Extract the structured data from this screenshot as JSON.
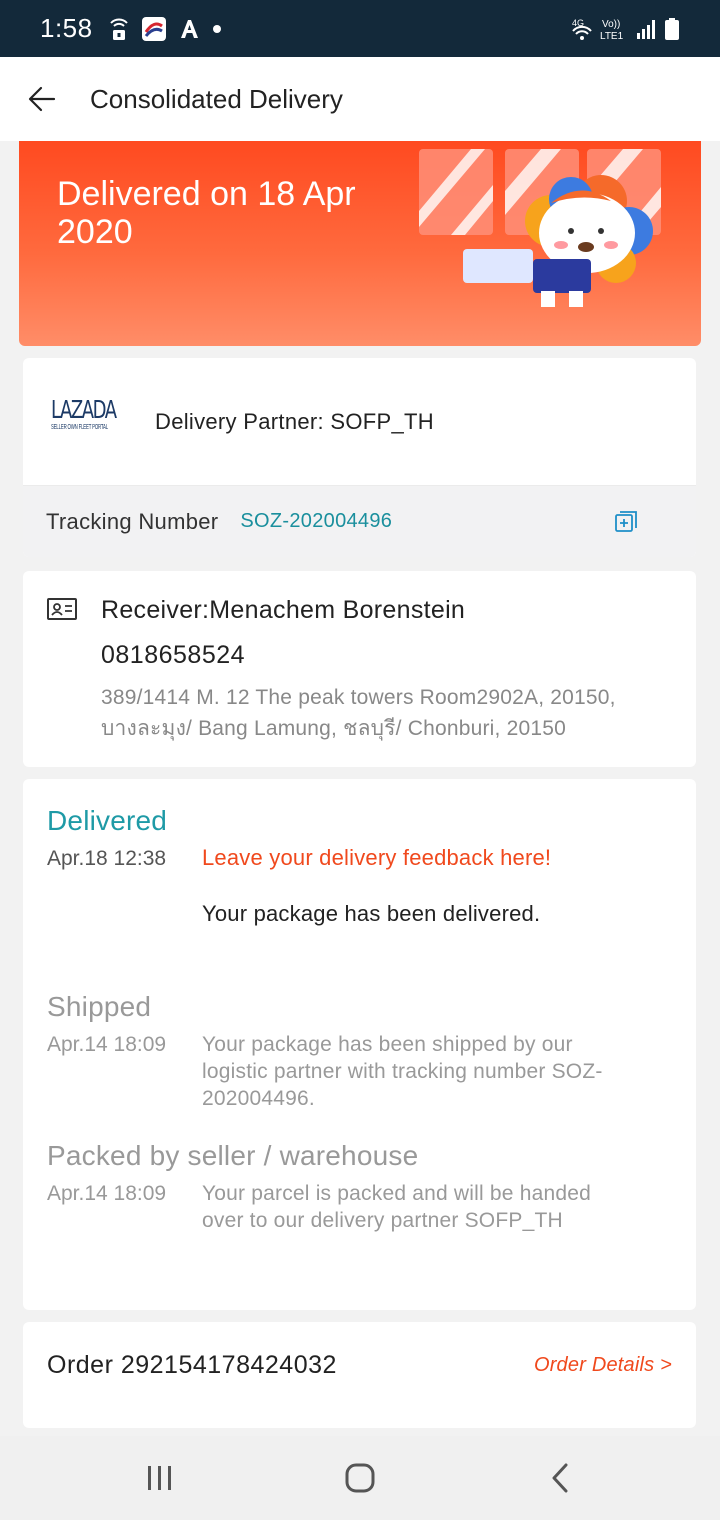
{
  "status_bar": {
    "time": "1:58",
    "network": "4G",
    "carrier_badge": "Vo)) LTE1"
  },
  "header": {
    "title": "Consolidated Delivery"
  },
  "banner": {
    "text": "Delivered on 18 Apr 2020",
    "color": "#ff4a20"
  },
  "partner": {
    "logo_text": "LAZADA",
    "logo_subtext": "SELLER OWN FLEET PORTAL",
    "label": "Delivery Partner: SOFP_TH",
    "tracking_label": "Tracking Number",
    "tracking_number": "SOZ-202004496"
  },
  "receiver": {
    "name_line": "Receiver:Menachem Borenstein",
    "phone": "0818658524",
    "address": "389/1414 M. 12 The peak towers Room2902A, 20150, บางละมุง/ Bang Lamung, ชลบุรี/ Chonburi, 20150"
  },
  "timeline": [
    {
      "status": "Delivered",
      "time": "Apr.18 12:38",
      "feedback_link": "Leave your delivery feedback here!",
      "message": "Your package has been delivered."
    },
    {
      "status": "Shipped",
      "time": "Apr.14 18:09",
      "message": "Your package has been shipped by our logistic partner with tracking number SOZ-202004496."
    },
    {
      "status": "Packed by seller / warehouse",
      "time": "Apr.14 18:09",
      "message": "Your parcel is packed and will be handed over to our delivery partner SOFP_TH"
    }
  ],
  "order": {
    "label": "Order 292154178424032",
    "details_link": "Order Details >"
  },
  "colors": {
    "accent": "#f0491d",
    "teal": "#1e9aa6",
    "status_bar": "#13293a"
  }
}
